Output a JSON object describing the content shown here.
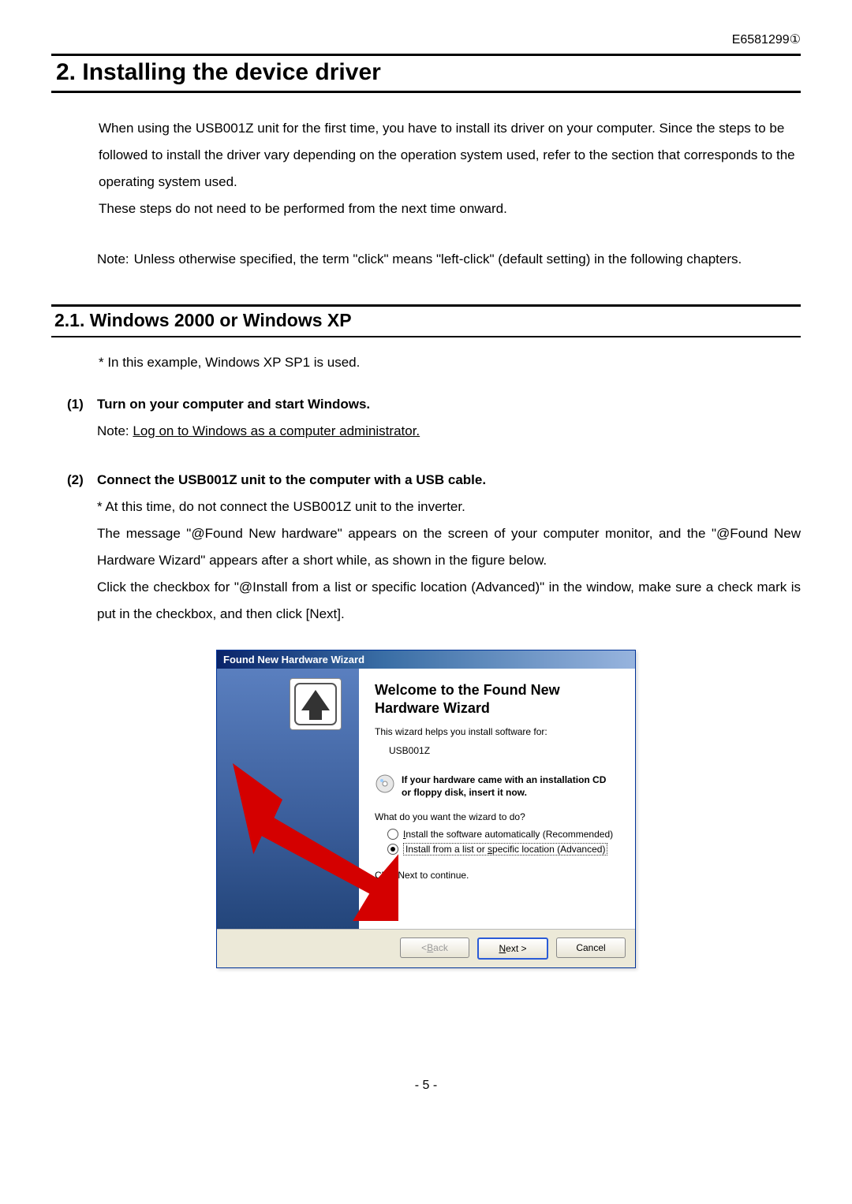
{
  "doc_id": "E6581299①",
  "h1": "2. Installing the device driver",
  "intro": {
    "p1": "When using the USB001Z unit for the first time, you have to install its driver on your computer. Since the steps to be followed to install the driver vary depending on the operation system used, refer to the section that corresponds to the operating system used.",
    "p2": "These steps do not need to be performed from the next time onward."
  },
  "note": {
    "label": "Note:",
    "text": "Unless otherwise specified, the term \"click\" means \"left-click\" (default setting) in the following chapters."
  },
  "h2": "2.1.   Windows 2000 or Windows XP",
  "sub_note": "* In this example, Windows XP SP1 is used.",
  "steps": [
    {
      "num": "(1)",
      "title": "Turn on your computer and start Windows.",
      "body_prefix": "Note: ",
      "body_underlined": "Log on to Windows as a computer administrator."
    },
    {
      "num": "(2)",
      "title": "Connect the USB001Z unit to the computer with a USB cable.",
      "lines": [
        "* At this time, do not connect the USB001Z unit to the inverter.",
        "The message \"@Found New hardware\" appears on the screen of your computer monitor, and the \"@Found New Hardware Wizard\" appears after a short while, as shown in the figure below.",
        "Click the checkbox for \"@Install from a list or specific location (Advanced)\" in the window, make sure a check mark is put in the checkbox, and then click [Next]."
      ]
    }
  ],
  "dialog": {
    "title": "Found New Hardware Wizard",
    "heading_l1": "Welcome to the Found New",
    "heading_l2": "Hardware Wizard",
    "helps": "This wizard helps you install software for:",
    "device": "USB001Z",
    "cd_l1": "If your hardware came with an installation CD",
    "cd_l2": "or floppy disk, insert it now.",
    "question": "What do you want the wizard to do?",
    "opt1_pre": "I",
    "opt1_rest": "nstall the software automatically (Recommended)",
    "opt2_pre": "Install from a list or ",
    "opt2_u": "s",
    "opt2_rest": "pecific location (Advanced)",
    "continue": "Click Next to continue.",
    "back_pre": "< ",
    "back_u": "B",
    "back_rest": "ack",
    "next_u": "N",
    "next_rest": "ext >",
    "cancel": "Cancel"
  },
  "page_num": "- 5 -"
}
